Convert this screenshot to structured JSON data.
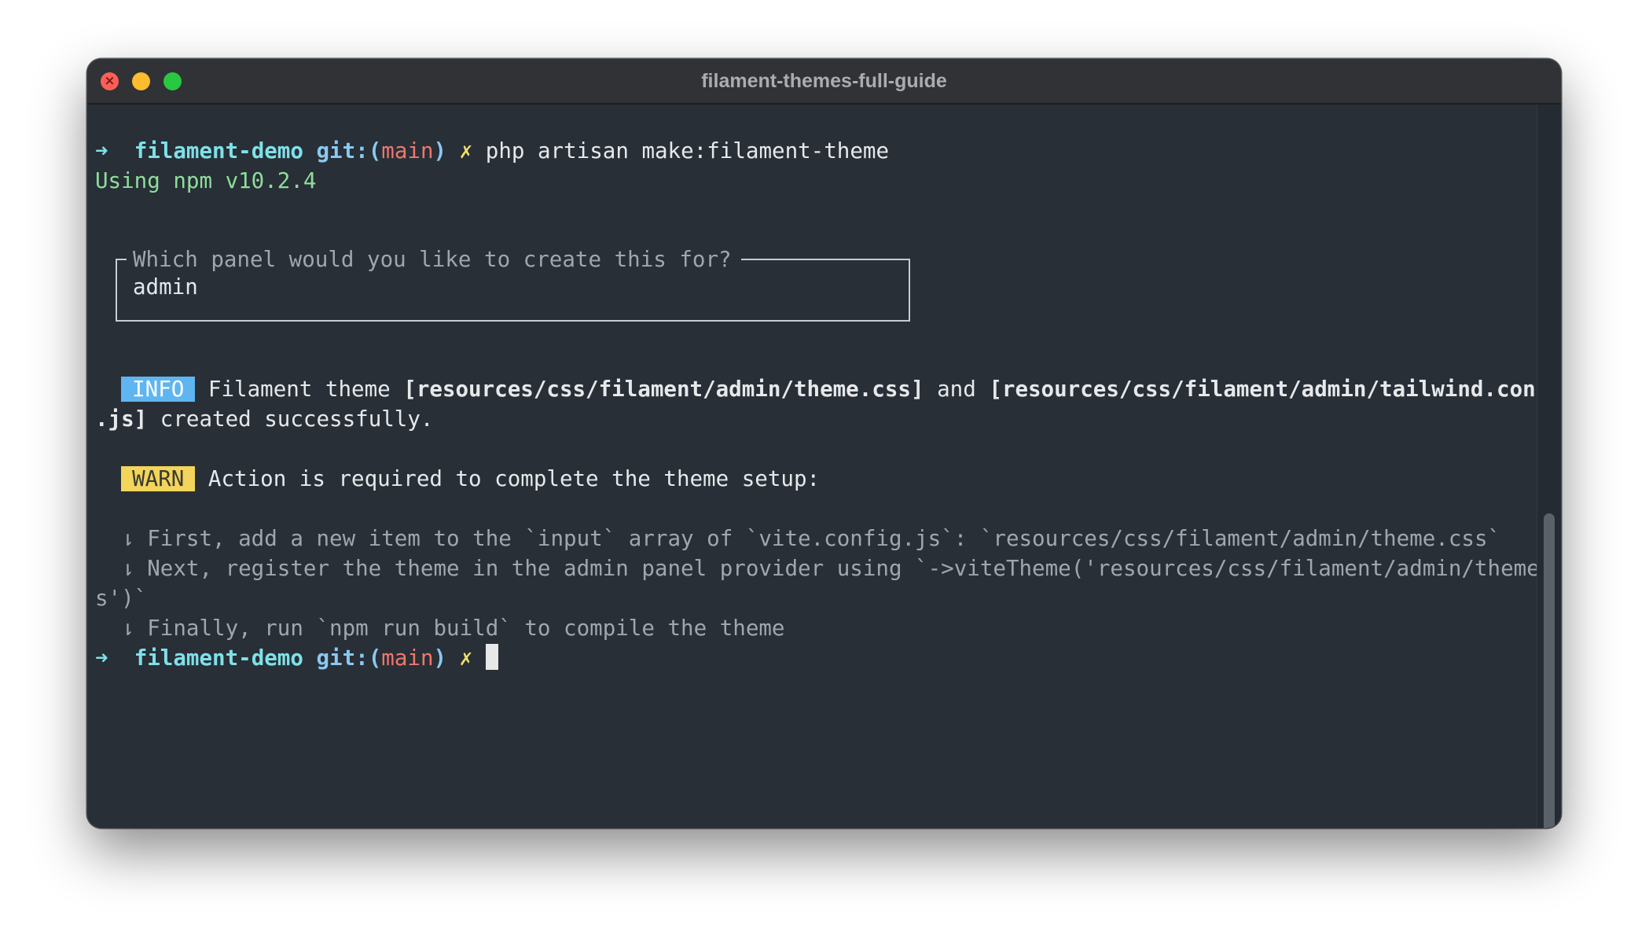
{
  "window": {
    "title": "filament-themes-full-guide"
  },
  "lines": {
    "prompt1": {
      "arrow": "➜",
      "dir": "filament-demo",
      "git_prefix": "git:(",
      "branch": "main",
      "git_suffix": ")",
      "dirty": "✗",
      "command": "php artisan make:filament-theme"
    },
    "npm_version": "Using npm v10.2.4",
    "panel_prompt": {
      "question": "Which panel would you like to create this for?",
      "answer": "admin"
    },
    "info": {
      "badge": "INFO",
      "text_1": " Filament theme ",
      "path_1": "[resources/css/filament/admin/theme.css]",
      "text_2": " and ",
      "path_2a": "[resources/css/filament/admin/tailwind.config",
      "path_2b": ".js]",
      "text_3": " created successfully."
    },
    "warn": {
      "badge": "WARN",
      "text": " Action is required to complete the theme setup:"
    },
    "steps": {
      "step1": "  ⇂ First, add a new item to the `input` array of `vite.config.js`: `resources/css/filament/admin/theme.css`",
      "step2a": "  ⇂ Next, register the theme in the admin panel provider using `->viteTheme('resources/css/filament/admin/theme.cs",
      "step2b": "s')`",
      "step3": "  ⇂ Finally, run `npm run build` to compile the theme"
    },
    "prompt2": {
      "arrow": "➜",
      "dir": "filament-demo",
      "git_prefix": "git:(",
      "branch": "main",
      "git_suffix": ")",
      "dirty": "✗"
    }
  },
  "colors": {
    "background": "#282f37",
    "titlebar": "#303236",
    "prompt_arrow": "#7fe0e8",
    "git_label": "#8ac8f0",
    "branch": "#f0776c",
    "dirty_mark": "#f2df6a",
    "npm_text": "#8fdd9b",
    "info_badge": "#5fb5ef",
    "warn_badge": "#f2d55a"
  }
}
